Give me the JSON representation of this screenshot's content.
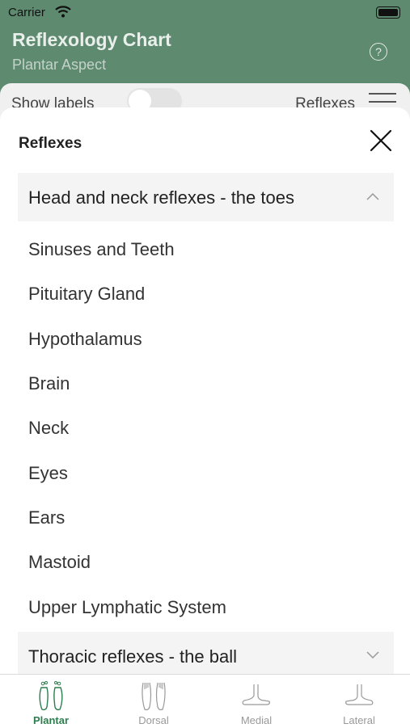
{
  "status_bar": {
    "carrier": "Carrier"
  },
  "header": {
    "title": "Reflexology Chart",
    "subtitle": "Plantar Aspect",
    "help_icon": "question-circle-icon"
  },
  "controls": {
    "show_labels": "Show labels",
    "reflexes": "Reflexes"
  },
  "sheet": {
    "title": "Reflexes",
    "sections": [
      {
        "label": "Head and neck reflexes - the toes",
        "expanded": true,
        "items": [
          "Sinuses and Teeth",
          "Pituitary Gland",
          "Hypothalamus",
          "Brain",
          "Neck",
          "Eyes",
          "Ears",
          "Mastoid",
          "Upper Lymphatic System"
        ]
      },
      {
        "label": "Thoracic reflexes - the ball",
        "expanded": false
      }
    ]
  },
  "tabs": [
    {
      "label": "Plantar",
      "active": true
    },
    {
      "label": "Dorsal",
      "active": false
    },
    {
      "label": "Medial",
      "active": false
    },
    {
      "label": "Lateral",
      "active": false
    }
  ],
  "colors": {
    "header": "#5e8a70",
    "accent": "#2e7d4f"
  }
}
